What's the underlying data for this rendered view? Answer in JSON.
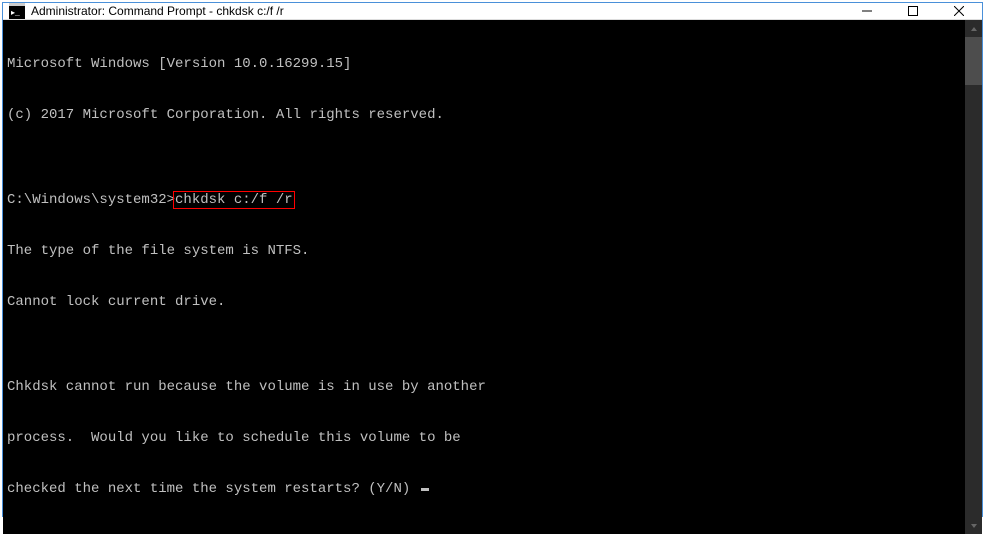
{
  "window": {
    "title": "Administrator: Command Prompt - chkdsk  c:/f /r"
  },
  "terminal": {
    "lines": [
      "Microsoft Windows [Version 10.0.16299.15]",
      "(c) 2017 Microsoft Corporation. All rights reserved.",
      "",
      "",
      "The type of the file system is NTFS.",
      "Cannot lock current drive.",
      "",
      "Chkdsk cannot run because the volume is in use by another",
      "process.  Would you like to schedule this volume to be",
      "checked the next time the system restarts? (Y/N) "
    ],
    "prompt": "C:\\Windows\\system32>",
    "command": "chkdsk c:/f /r"
  }
}
